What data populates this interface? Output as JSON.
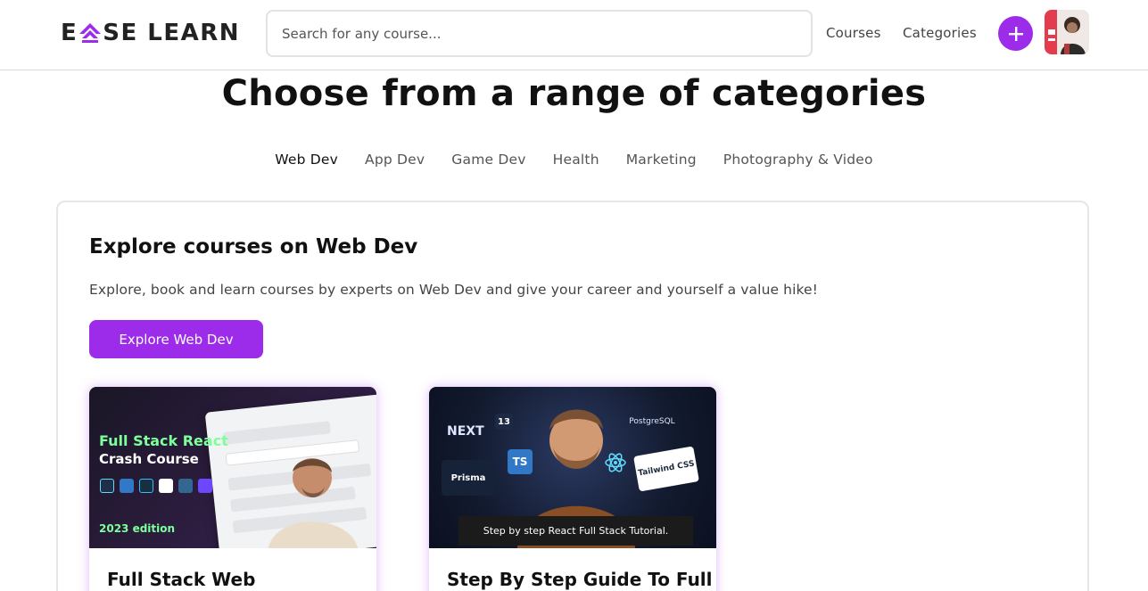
{
  "header": {
    "logo_text_1": "E",
    "logo_text_2": "SE LEARN",
    "search_placeholder": "Search for any course...",
    "nav": [
      {
        "label": "Courses"
      },
      {
        "label": "Categories"
      }
    ],
    "add_icon": "plus-icon",
    "accent_color": "#9d2bea"
  },
  "page": {
    "title": "Choose from a range of categories"
  },
  "tabs": [
    {
      "label": "Web Dev",
      "active": true
    },
    {
      "label": "App Dev",
      "active": false
    },
    {
      "label": "Game Dev",
      "active": false
    },
    {
      "label": "Health",
      "active": false
    },
    {
      "label": "Marketing",
      "active": false
    },
    {
      "label": "Photography & Video",
      "active": false
    }
  ],
  "panel": {
    "title": "Explore courses on Web Dev",
    "description": "Explore, book and learn courses by experts on Web Dev and give your career and yourself a value hike!",
    "button_label": "Explore Web Dev"
  },
  "courses": [
    {
      "title": "Full Stack Web",
      "thumb": {
        "line1": "Full Stack React",
        "line2": "Crash Course",
        "edition": "2023 edition"
      }
    },
    {
      "title": "Step By Step Guide To Full",
      "thumb": {
        "next": "NEXT",
        "next_version": "13",
        "postgres": "PostgreSQL",
        "prisma": "Prisma",
        "ts": "TS",
        "tailwind": "Tailwind CSS",
        "caption": "Step by step React Full Stack Tutorial."
      }
    }
  ]
}
